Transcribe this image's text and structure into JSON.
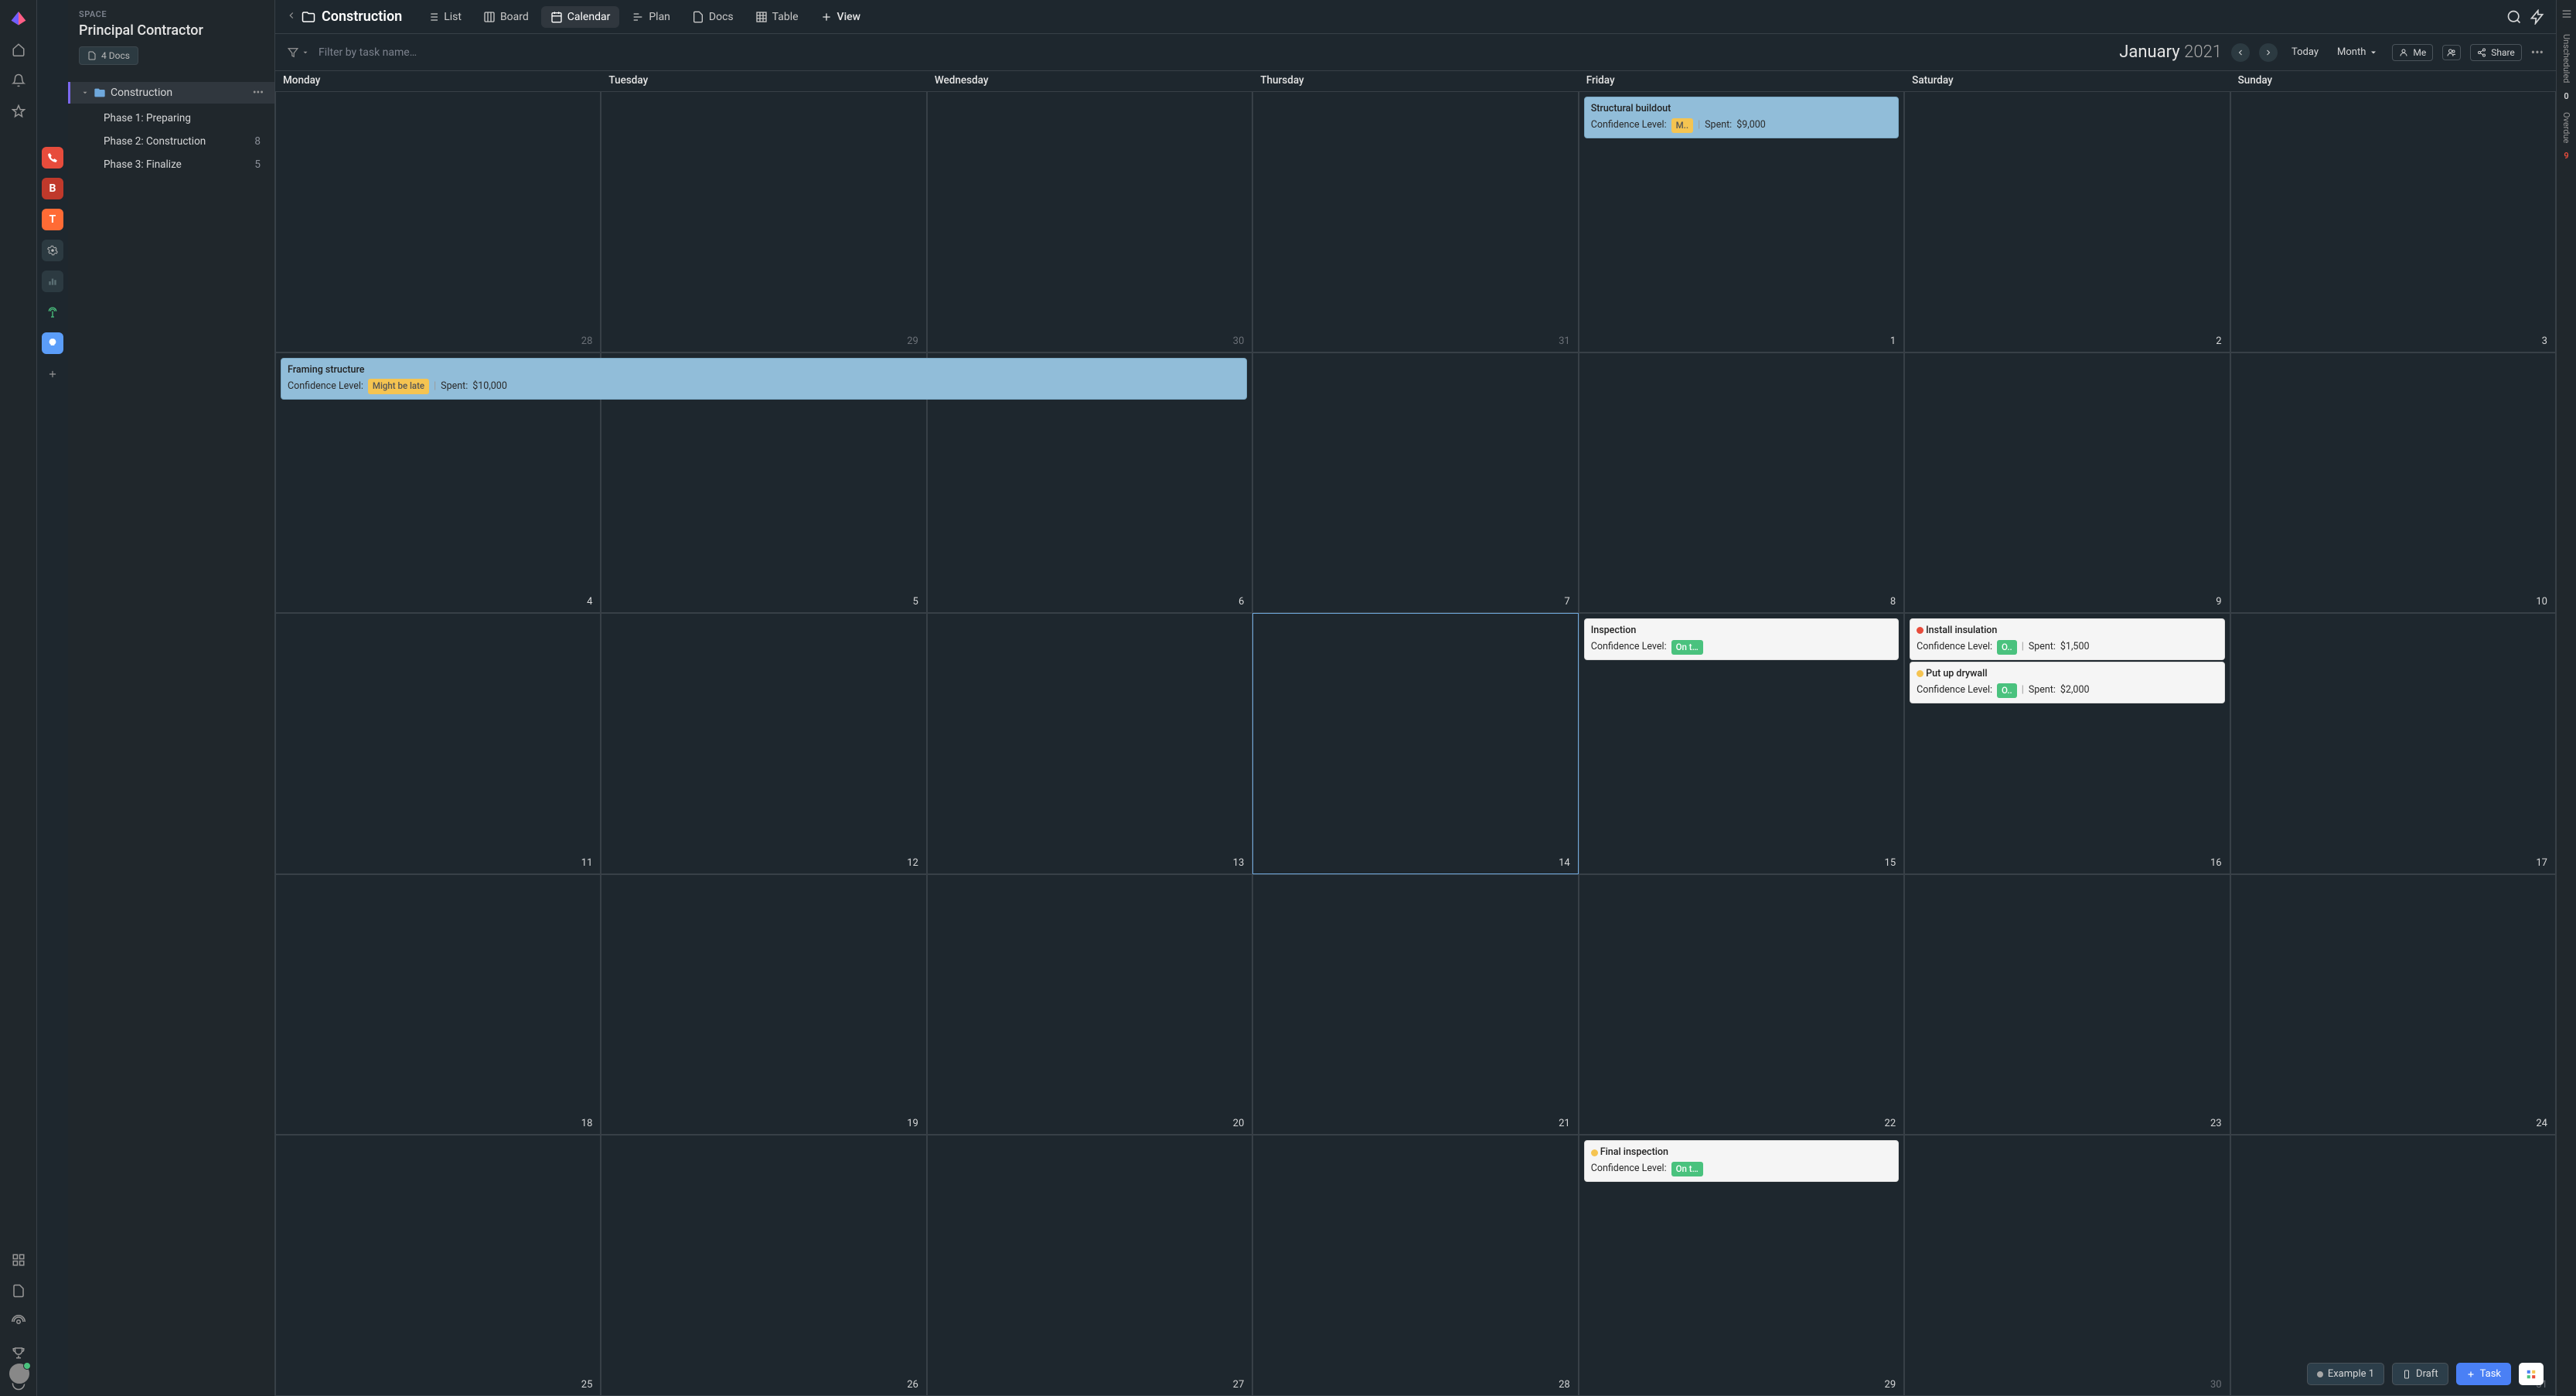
{
  "workspace": {
    "type_label": "SPACE",
    "name": "Principal Contractor",
    "docs_pill": "4 Docs"
  },
  "tree": {
    "root": "Construction",
    "items": [
      {
        "label": "Phase 1: Preparing",
        "count": ""
      },
      {
        "label": "Phase 2: Construction",
        "count": "8"
      },
      {
        "label": "Phase 3: Finalize",
        "count": "5"
      }
    ]
  },
  "breadcrumb": {
    "title": "Construction"
  },
  "view_tabs": [
    {
      "label": "List"
    },
    {
      "label": "Board"
    },
    {
      "label": "Calendar"
    },
    {
      "label": "Plan"
    },
    {
      "label": "Docs"
    },
    {
      "label": "Table"
    }
  ],
  "add_view_label": "View",
  "toolbar": {
    "filter_placeholder": "Filter by task name…",
    "period_month": "January",
    "period_year": "2021",
    "today": "Today",
    "range": "Month",
    "me_label": "Me",
    "share_label": "Share"
  },
  "days": [
    "Monday",
    "Tuesday",
    "Wednesday",
    "Thursday",
    "Friday",
    "Saturday",
    "Sunday"
  ],
  "grid": [
    [
      {
        "n": "28",
        "muted": true
      },
      {
        "n": "29",
        "muted": true
      },
      {
        "n": "30",
        "muted": true
      },
      {
        "n": "31",
        "muted": true
      },
      {
        "n": "1"
      },
      {
        "n": "2"
      },
      {
        "n": "3"
      }
    ],
    [
      {
        "n": "4"
      },
      {
        "n": "5"
      },
      {
        "n": "6"
      },
      {
        "n": "7"
      },
      {
        "n": "8"
      },
      {
        "n": "9"
      },
      {
        "n": "10"
      }
    ],
    [
      {
        "n": "11"
      },
      {
        "n": "12"
      },
      {
        "n": "13"
      },
      {
        "n": "14",
        "today": true
      },
      {
        "n": "15"
      },
      {
        "n": "16"
      },
      {
        "n": "17"
      }
    ],
    [
      {
        "n": "18"
      },
      {
        "n": "19"
      },
      {
        "n": "20"
      },
      {
        "n": "21"
      },
      {
        "n": "22"
      },
      {
        "n": "23"
      },
      {
        "n": "24"
      }
    ],
    [
      {
        "n": "25"
      },
      {
        "n": "26"
      },
      {
        "n": "27"
      },
      {
        "n": "28"
      },
      {
        "n": "29"
      },
      {
        "n": "30",
        "muted": true
      },
      {
        "n": "31",
        "muted": true
      }
    ]
  ],
  "events": {
    "structural": {
      "title": "Structural buildout",
      "cl_label": "Confidence Level:",
      "badge": "M..",
      "spent_label": "Spent:",
      "spent": "$9,000"
    },
    "framing": {
      "title": "Framing structure",
      "cl_label": "Confidence Level:",
      "badge": "Might be late",
      "spent_label": "Spent:",
      "spent": "$10,000"
    },
    "inspection": {
      "title": "Inspection",
      "cl_label": "Confidence Level:",
      "badge": "On t…"
    },
    "insulation": {
      "title": "Install insulation",
      "cl_label": "Confidence Level:",
      "badge": "O..",
      "spent_label": "Spent:",
      "spent": "$1,500"
    },
    "drywall": {
      "title": "Put up drywall",
      "cl_label": "Confidence Level:",
      "badge": "O..",
      "spent_label": "Spent:",
      "spent": "$2,000"
    },
    "final": {
      "title": "Final inspection",
      "cl_label": "Confidence Level:",
      "badge": "On t…"
    }
  },
  "rightrail": {
    "unscheduled_label": "Unscheduled",
    "unscheduled_n": "0",
    "overdue_label": "Overdue",
    "overdue_n": "9"
  },
  "footer": {
    "example": "Example 1",
    "draft": "Draft",
    "task": "Task"
  },
  "pins": {
    "b": "B",
    "t": "T"
  }
}
